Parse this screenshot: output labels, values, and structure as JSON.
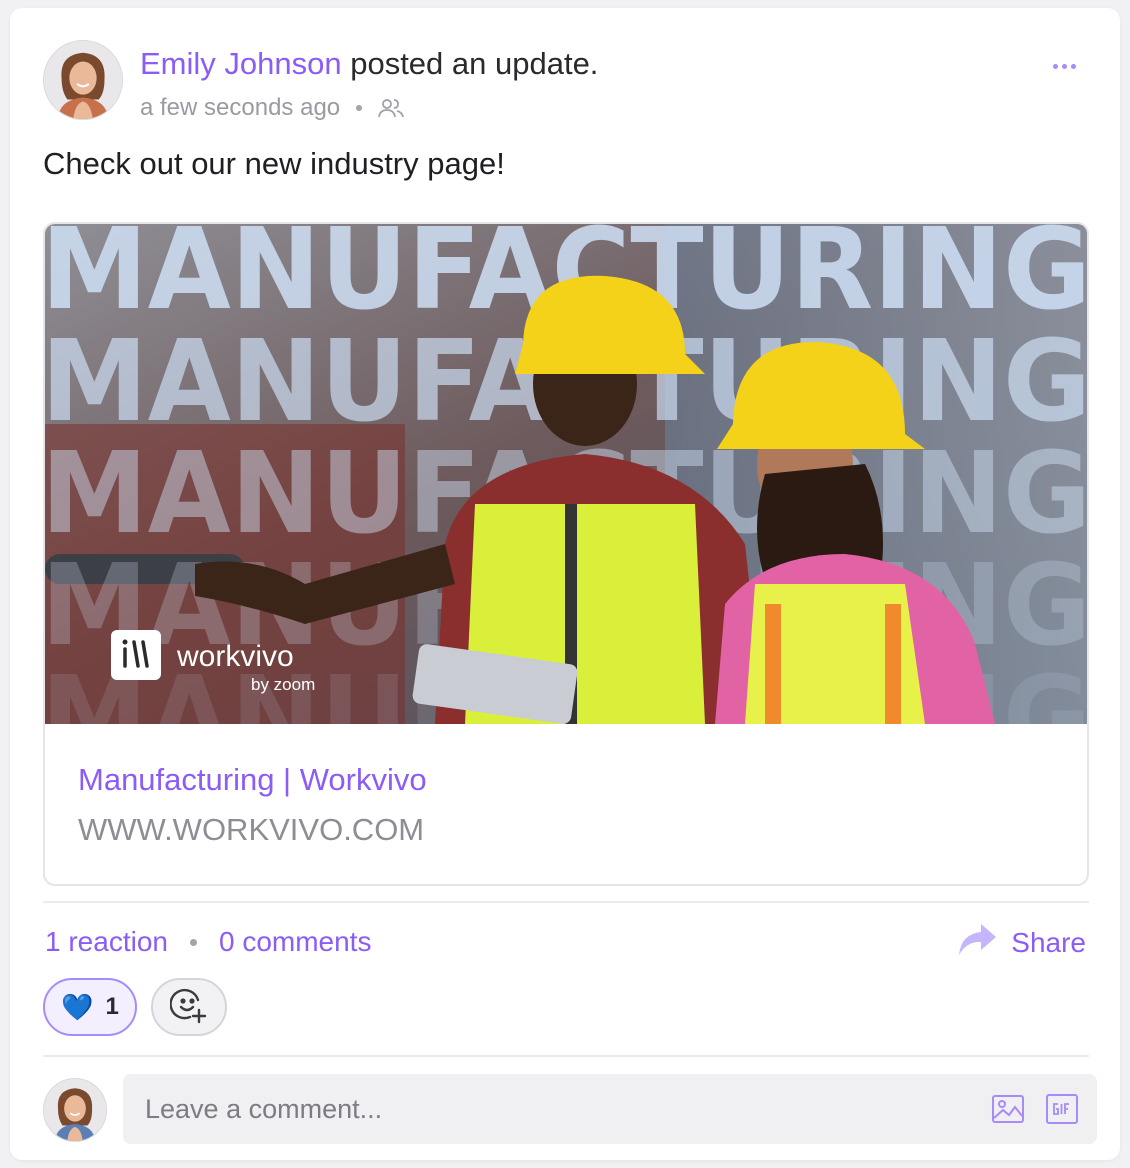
{
  "post": {
    "author": "Emily Johnson",
    "action": " posted an update.",
    "time": "a few seconds ago",
    "text": "Check out our new industry page!"
  },
  "link": {
    "banner_word": "MANUFACTURING",
    "brand": "workvivo",
    "brand_sub": "by zoom",
    "title": "Manufacturing | Workvivo",
    "domain": "WWW.WORKVIVO.COM"
  },
  "stats": {
    "reactions": "1 reaction",
    "comments": "0 comments",
    "share": "Share"
  },
  "reaction": {
    "emoji": "💙",
    "count": "1"
  },
  "comment": {
    "placeholder": "Leave a comment..."
  },
  "colors": {
    "accent": "#8b5cf6",
    "accent_light": "#a78bfa",
    "text": "#1f1f23",
    "muted": "#9a9aa2"
  }
}
